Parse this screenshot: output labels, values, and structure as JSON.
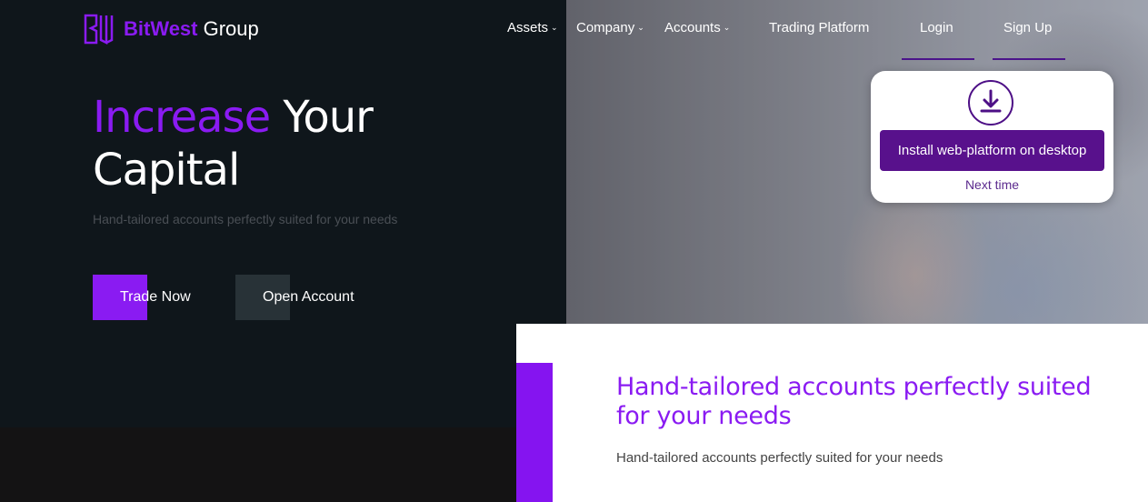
{
  "brand": {
    "name_bold": "BitWest",
    "name_rest": " Group"
  },
  "nav": {
    "assets": "Assets",
    "company": "Company",
    "accounts": "Accounts",
    "trading_platform": "Trading Platform",
    "login": "Login",
    "signup": "Sign Up"
  },
  "popup": {
    "install_label": "Install web-platform on desktop",
    "next_time": "Next time"
  },
  "hero": {
    "headline_accent": "Increase",
    "headline_rest1": " Your",
    "headline_line2": "Capital",
    "subhead": "Hand-tailored accounts perfectly suited for your needs",
    "trade_now": "Trade Now",
    "open_account": "Open Account"
  },
  "card": {
    "title": "Hand-tailored accounts perfectly suited for your needs",
    "text": "Hand-tailored accounts perfectly suited for your needs"
  },
  "colors": {
    "accent": "#8a1bf2",
    "popup_button": "#58118c",
    "dark_bg": "#0f161b"
  }
}
